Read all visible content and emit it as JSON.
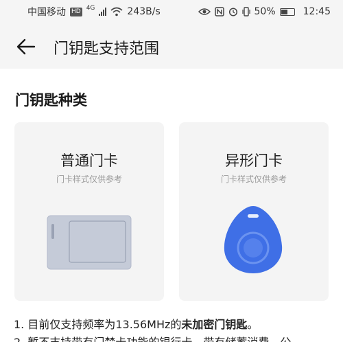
{
  "status_bar": {
    "carrier": "中国移动",
    "hd": "HD",
    "network": "4G",
    "speed": "243B/s",
    "battery": "50%",
    "time": "12:45"
  },
  "header": {
    "title": "门钥匙支持范围"
  },
  "section": {
    "title": "门钥匙种类"
  },
  "cards": [
    {
      "title": "普通门卡",
      "subtitle": "门卡样式仅供参考"
    },
    {
      "title": "异形门卡",
      "subtitle": "门卡样式仅供参考"
    }
  ],
  "notes": {
    "line1_prefix": "1. 目前仅支持频率为13.56MHz的",
    "line1_bold": "未加密门钥匙",
    "line1_suffix": "。",
    "line2": "2. 暂不支持带有门禁卡功能的银行卡、带有储蓄消费、公"
  },
  "colors": {
    "header_bg": "#f5f5f5",
    "card_bg": "#f4f4f4",
    "key_fob_blue": "#3f6fe6",
    "card_grey": "#c5cbd8"
  }
}
